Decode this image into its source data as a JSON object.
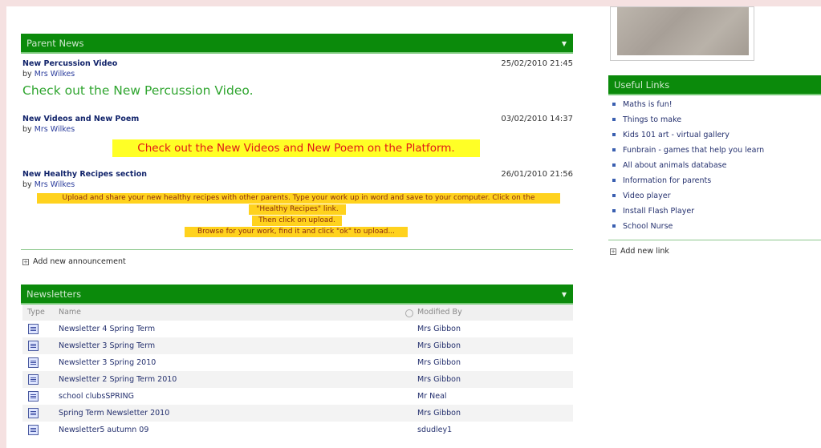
{
  "parent_news": {
    "header": "Parent News",
    "items": [
      {
        "title": "New Percussion Video",
        "by_prefix": "by",
        "author": "Mrs Wilkes",
        "date": "25/02/2010 21:45",
        "body": "Check out the New Percussion Video."
      },
      {
        "title": "New Videos and New Poem",
        "by_prefix": "by",
        "author": "Mrs Wilkes",
        "date": "03/02/2010 14:37",
        "body": "Check out the New Videos and New Poem on the Platform."
      },
      {
        "title": "New Healthy Recipes section",
        "by_prefix": "by",
        "author": "Mrs Wilkes",
        "date": "26/01/2010 21:56",
        "body_lines": [
          "Upload and share your new healthy recipes with other parents.  Type your work up in word and save to your computer.  Click on the",
          "\"Healthy Recipes\" link.",
          "Then click on upload.",
          "Browse for your work, find it and click \"ok\" to upload..."
        ]
      }
    ],
    "add_label": "Add new announcement"
  },
  "newsletters": {
    "header": "Newsletters",
    "columns": {
      "type": "Type",
      "name": "Name",
      "modified_by": "Modified By"
    },
    "rows": [
      {
        "name": "Newsletter 4 Spring Term",
        "modified_by": "Mrs Gibbon"
      },
      {
        "name": "Newsletter 3 Spring Term",
        "modified_by": "Mrs Gibbon"
      },
      {
        "name": "Newsletter 3 Spring 2010",
        "modified_by": "Mrs Gibbon"
      },
      {
        "name": "Newsletter 2 Spring Term 2010",
        "modified_by": "Mrs Gibbon"
      },
      {
        "name": "school clubsSPRING",
        "modified_by": "Mr Neal"
      },
      {
        "name": "Spring Term Newsletter 2010",
        "modified_by": "Mrs Gibbon"
      },
      {
        "name": "Newsletter5 autumn 09",
        "modified_by": "sdudley1"
      }
    ]
  },
  "useful_links": {
    "header": "Useful Links",
    "items": [
      "Maths is fun!",
      "Things to make",
      "Kids 101 art - virtual gallery",
      "Funbrain - games that help you learn",
      "All about animals database",
      "Information for parents",
      "Video player",
      "Install Flash Player",
      "School Nurse"
    ],
    "add_label": "Add new link"
  },
  "icons": {
    "dropdown": "chevron-down-icon",
    "document": "word-document-icon",
    "plus": "plus-box-icon",
    "bullet": "bullet-icon",
    "sort": "sort-circle-icon"
  },
  "colors": {
    "header_green": "#0b8a0b",
    "highlight_yellow": "#ffff26",
    "highlight_orange": "#ffd21e",
    "alert_red": "#e01616",
    "body_green": "#2fa52f"
  }
}
